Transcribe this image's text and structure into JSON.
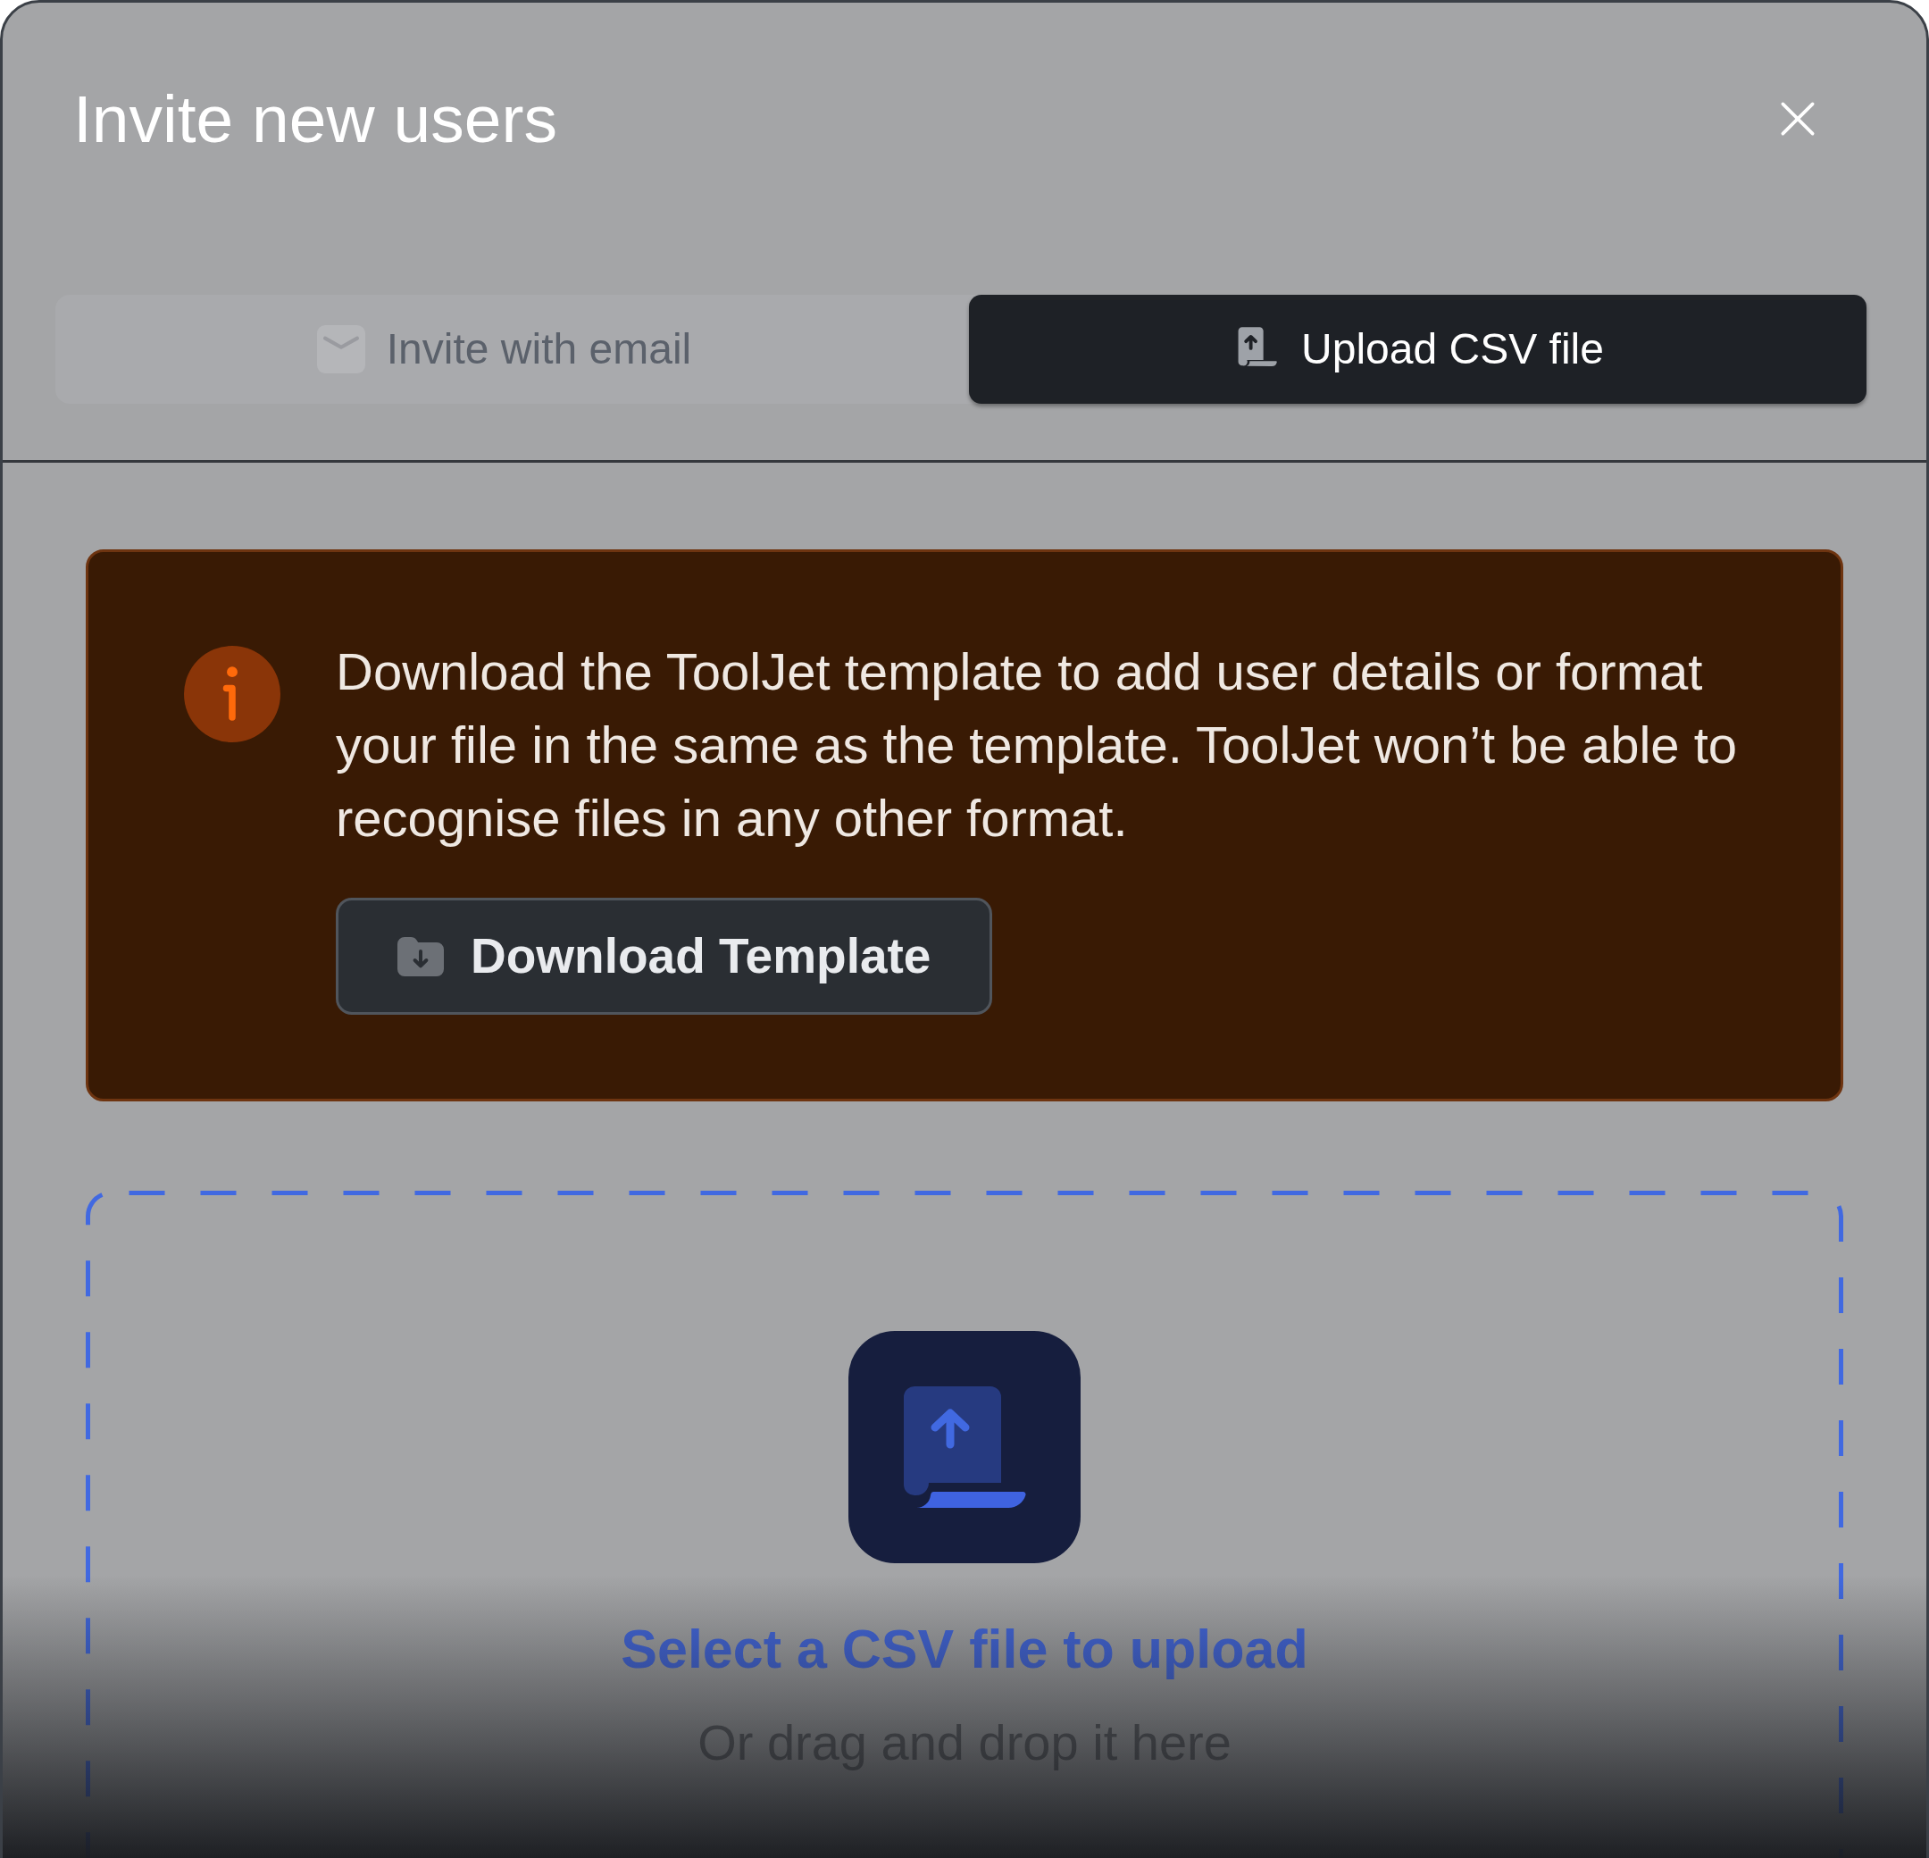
{
  "dialog": {
    "title": "Invite new users"
  },
  "tabs": [
    {
      "label": "Invite with email",
      "selected": false,
      "kind": "email"
    },
    {
      "label": "Upload CSV file",
      "selected": true,
      "kind": "upload"
    }
  ],
  "notice": {
    "text": "Download the ToolJet template to add user details or format your file in the same as the template. ToolJet won’t be able to recognise files in any other format.",
    "button": "Download Template"
  },
  "dropzone": {
    "title": "Select a CSV file to upload",
    "hint": "Or drag and drop it here"
  }
}
